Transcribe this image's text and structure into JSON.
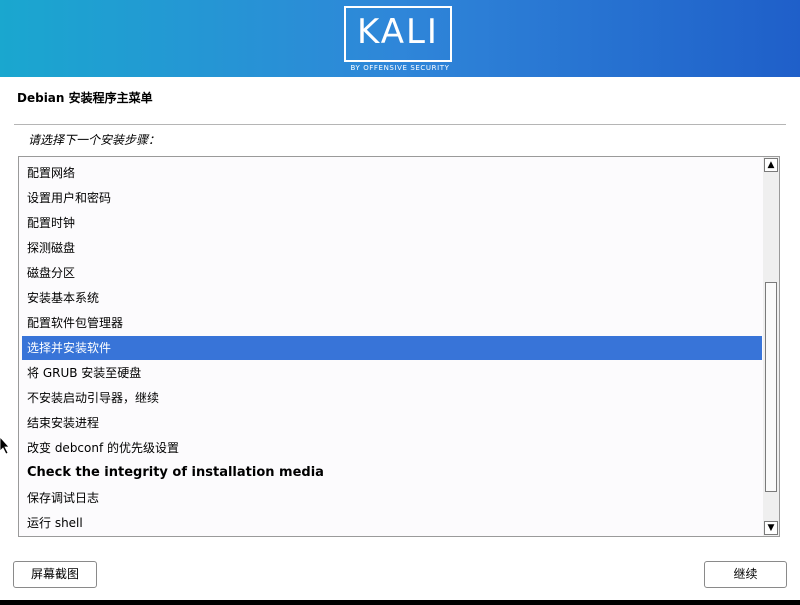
{
  "header": {
    "logo_text": "KALI",
    "logo_subtitle": "BY OFFENSIVE SECURITY",
    "gradient_colors": [
      "#1aa7cf",
      "#2f86d9",
      "#1f5fc9"
    ]
  },
  "page": {
    "title": "Debian 安装程序主菜单",
    "prompt": "请选择下一个安装步骤："
  },
  "menu": {
    "selected_index": 7,
    "selection_color": "#3874d8",
    "items": [
      {
        "label": "配置网络"
      },
      {
        "label": "设置用户和密码"
      },
      {
        "label": "配置时钟"
      },
      {
        "label": "探测磁盘"
      },
      {
        "label": "磁盘分区"
      },
      {
        "label": "安装基本系统"
      },
      {
        "label": "配置软件包管理器"
      },
      {
        "label": "选择并安装软件"
      },
      {
        "label": "将 GRUB 安装至硬盘"
      },
      {
        "label": "不安装启动引导器，继续"
      },
      {
        "label": "结束安装进程"
      },
      {
        "label": "改变 debconf 的优先级设置"
      },
      {
        "label": "Check the integrity of installation media"
      },
      {
        "label": "保存调试日志"
      },
      {
        "label": "运行 shell"
      }
    ]
  },
  "scrollbar": {
    "up_icon": "chevron-up-icon",
    "down_icon": "chevron-down-icon"
  },
  "buttons": {
    "screenshot_label": "屏幕截图",
    "continue_label": "继续"
  }
}
